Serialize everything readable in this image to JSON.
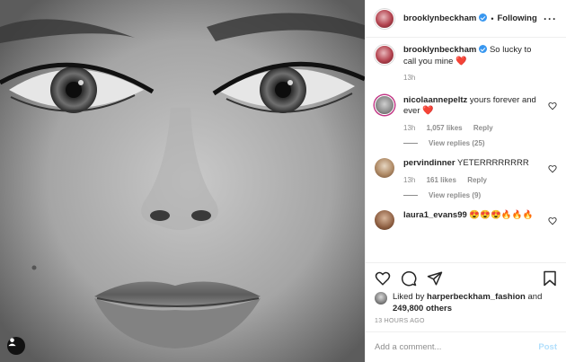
{
  "header": {
    "username": "brooklynbeckham",
    "separator": "•",
    "follow_label": "Following"
  },
  "caption": {
    "username": "brooklynbeckham",
    "text": "So lucky to call you mine",
    "heart": "❤️",
    "time": "13h"
  },
  "comments": [
    {
      "username": "nicolaannepeltz",
      "text": "yours forever and ever",
      "heart": "❤️",
      "time": "13h",
      "likes": "1,057 likes",
      "reply_label": "Reply",
      "view_replies": "View replies (25)"
    },
    {
      "username": "pervindinner",
      "text": "YETERRRRRRRR",
      "time": "13h",
      "likes": "161 likes",
      "reply_label": "Reply",
      "view_replies": "View replies (9)"
    },
    {
      "username": "laura1_evans99",
      "text": "😍😍😍🔥🔥🔥"
    }
  ],
  "likes": {
    "prefix": "Liked by",
    "liker": "harperbeckham_fashion",
    "and": "and",
    "others": "249,800 others"
  },
  "timestamp": "13 HOURS AGO",
  "add_comment": {
    "placeholder": "Add a comment...",
    "post_label": "Post"
  },
  "icons": [
    "heart-icon",
    "comment-icon",
    "share-icon",
    "bookmark-icon",
    "more-icon",
    "user-tag-icon"
  ],
  "colors": {
    "verified": "#3897f0",
    "heart": "#ed4956",
    "post_button": "#b2dffc",
    "secondary_text": "#8e8e8e"
  }
}
